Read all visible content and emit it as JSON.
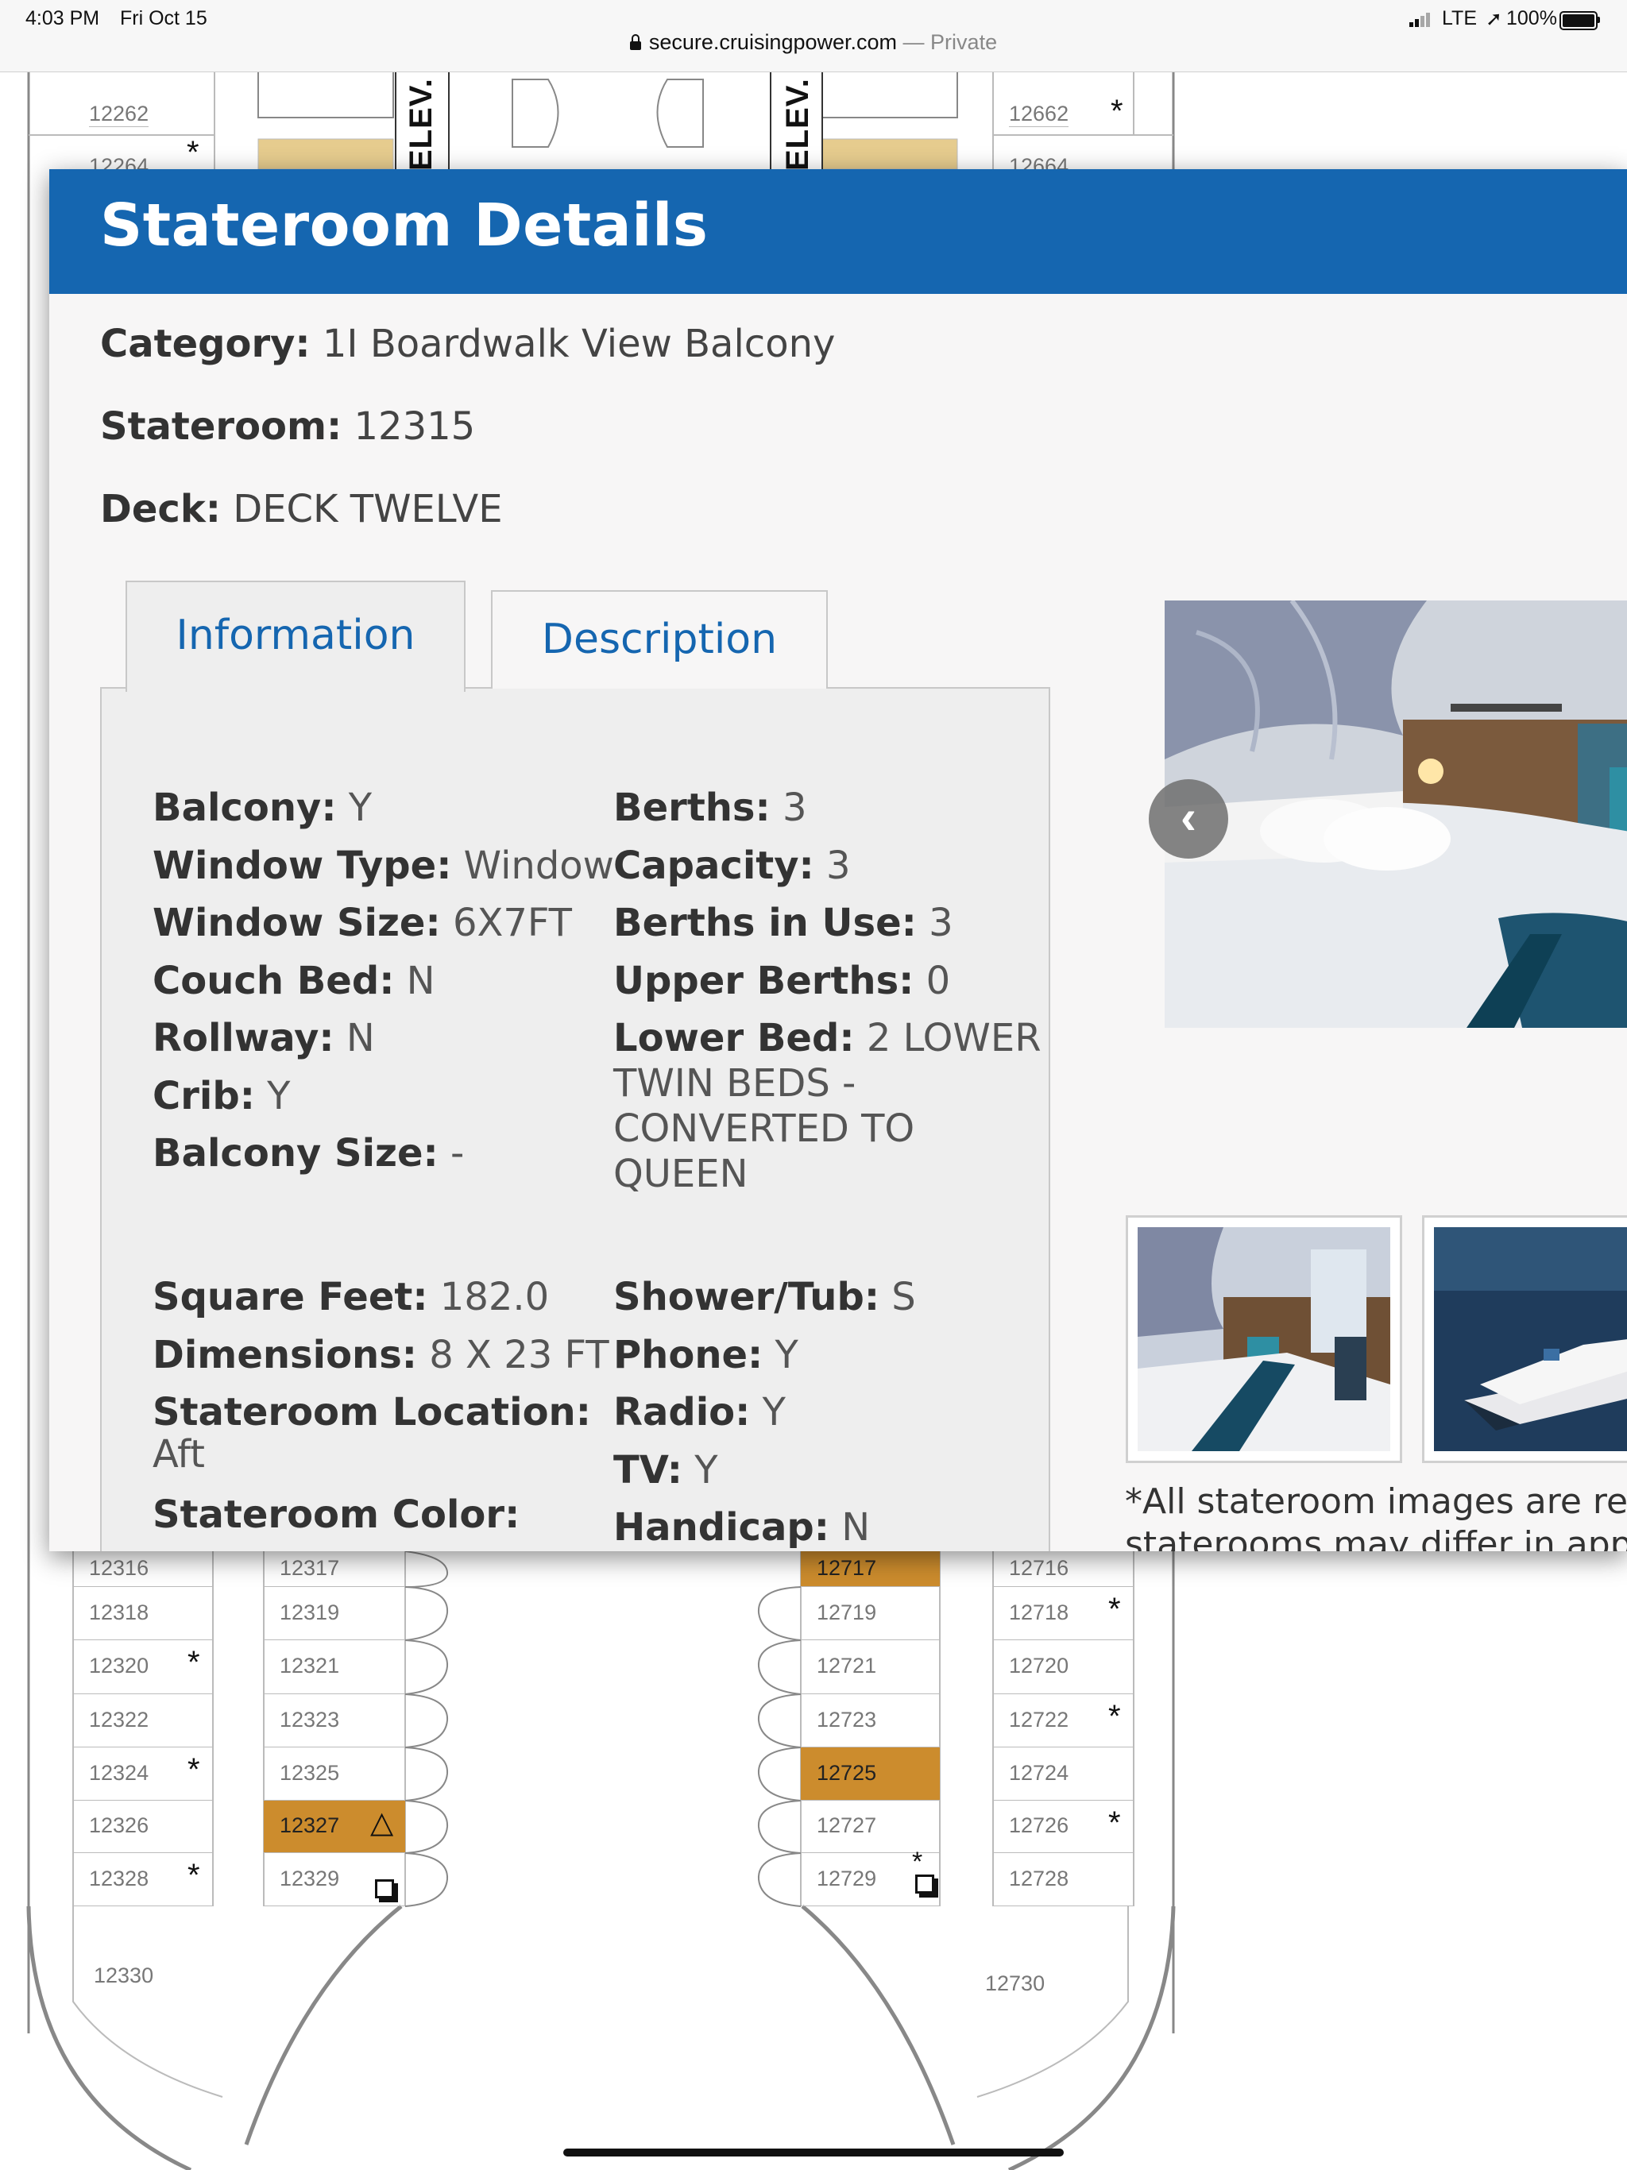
{
  "status_bar": {
    "time": "4:03 PM",
    "date": "Fri Oct 15",
    "network": "LTE",
    "battery": "100%",
    "url_host": "secure.cruisingpower.com",
    "url_suffix": "— Private"
  },
  "deck_map": {
    "elev_label": "ELEV.",
    "top_cabins": [
      "12262",
      "12264",
      "12662",
      "12664"
    ],
    "left_outer": [
      "12316",
      "12318",
      "12320",
      "12322",
      "12324",
      "12326",
      "12328"
    ],
    "left_inner": [
      "12317",
      "12319",
      "12321",
      "12323",
      "12325",
      "12327",
      "12329"
    ],
    "right_inner": [
      "12717",
      "12719",
      "12721",
      "12723",
      "12725",
      "12727",
      "12729"
    ],
    "right_outer": [
      "12716",
      "12718",
      "12720",
      "12722",
      "12724",
      "12726",
      "12728"
    ],
    "aft_left": "12330",
    "aft_right": "12730",
    "highlighted": [
      "12327",
      "12717",
      "12725"
    ],
    "accessible_marker": "△",
    "star_marker": "*"
  },
  "modal": {
    "title": "Stateroom Details",
    "category_label": "Category:",
    "category_value": "1I Boardwalk View Balcony",
    "stateroom_label": "Stateroom:",
    "stateroom_value": "12315",
    "deck_label": "Deck:",
    "deck_value": "DECK TWELVE",
    "tabs": [
      {
        "label": "Information",
        "active": true
      },
      {
        "label": "Description",
        "active": false
      }
    ],
    "info_left": [
      {
        "label": "Balcony:",
        "value": "Y"
      },
      {
        "label": "Window Type:",
        "value": "Window"
      },
      {
        "label": "Window Size:",
        "value": "6X7FT"
      },
      {
        "label": "Couch Bed:",
        "value": "N"
      },
      {
        "label": "Rollway:",
        "value": "N"
      },
      {
        "label": "Crib:",
        "value": "Y"
      },
      {
        "label": "Balcony Size:",
        "value": "-"
      }
    ],
    "info_right": [
      {
        "label": "Berths:",
        "value": "3"
      },
      {
        "label": "Capacity:",
        "value": "3"
      },
      {
        "label": "Berths in Use:",
        "value": "3"
      },
      {
        "label": "Upper Berths:",
        "value": "0"
      },
      {
        "label": "Lower Bed:",
        "value": "2 LOWER"
      }
    ],
    "lower_bed_continued": [
      "TWIN BEDS -",
      "CONVERTED TO",
      "QUEEN"
    ],
    "info_left_2": [
      {
        "label": "Square Feet:",
        "value": "182.0"
      },
      {
        "label": "Dimensions:",
        "value": "8 X 23 FT"
      },
      {
        "label": "Stateroom Location:",
        "value": ""
      },
      {
        "label": "",
        "value": "Aft"
      },
      {
        "label": "Stateroom Color:",
        "value": ""
      }
    ],
    "info_right_2": [
      {
        "label": "Shower/Tub:",
        "value": "S"
      },
      {
        "label": "Phone:",
        "value": "Y"
      },
      {
        "label": "Radio:",
        "value": "Y"
      },
      {
        "label": "TV:",
        "value": "Y"
      },
      {
        "label": "Handicap:",
        "value": "N"
      }
    ],
    "caption": "*All stateroom images are represe",
    "caption_line2": "staterooms may differ in appeara"
  }
}
